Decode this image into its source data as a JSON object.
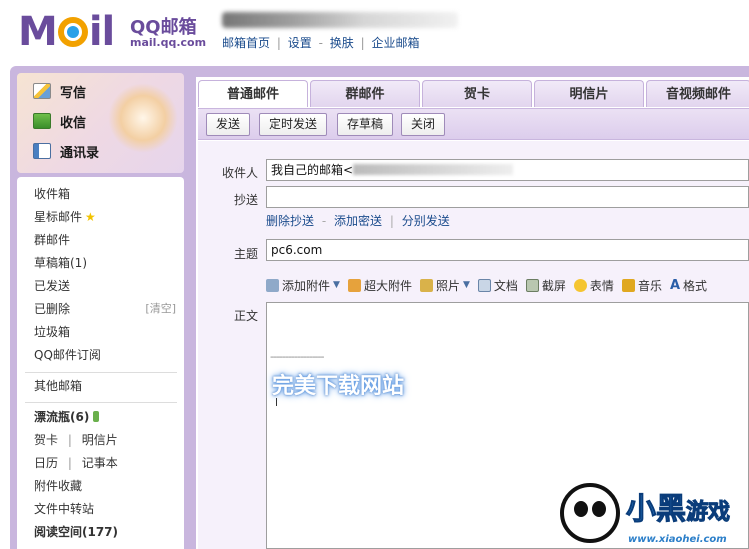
{
  "header": {
    "brand_title": "QQ邮箱",
    "brand_sub": "mail.qq.com",
    "links": [
      "邮箱首页",
      "设置",
      "换肤",
      "企业邮箱"
    ],
    "link_sep_1": "|",
    "link_sep_2": "-",
    "link_sep_3": "|"
  },
  "sidebar": {
    "actions": [
      {
        "label": "写信",
        "icon": "pencil-paper-icon"
      },
      {
        "label": "收信",
        "icon": "inbox-download-icon"
      },
      {
        "label": "通讯录",
        "icon": "address-book-icon"
      }
    ],
    "folders": [
      "收件箱",
      "星标邮件",
      "群邮件",
      "草稿箱(1)",
      "已发送",
      "已删除",
      "垃圾箱",
      "QQ邮件订阅"
    ],
    "clear_label": "[清空]",
    "other_mailbox": "其他邮箱",
    "drift_bottle": "漂流瓶(6)",
    "card": "贺卡",
    "postcard": "明信片",
    "calendar": "日历",
    "notes": "记事本",
    "attachments": "附件收藏",
    "file_transfer": "文件中转站",
    "reading": "阅读空间(177)",
    "pipe": "|"
  },
  "compose": {
    "tabs": [
      "普通邮件",
      "群邮件",
      "贺卡",
      "明信片",
      "音视频邮件"
    ],
    "toolbar": [
      "发送",
      "定时发送",
      "存草稿",
      "关闭"
    ],
    "to_label": "收件人",
    "to_value": "我自己的邮箱<",
    "cc_label": "抄送",
    "cc_value": "",
    "cc_links": [
      "删除抄送",
      "添加密送",
      "分别发送"
    ],
    "cc_sep_1": "-",
    "cc_sep_2": "|",
    "subject_label": "主题",
    "subject_value": "pc6.com",
    "edit_tools": [
      {
        "label": "添加附件",
        "icon": "paperclip-icon",
        "dropdown": true
      },
      {
        "label": "超大附件",
        "icon": "big-attachment-icon",
        "dropdown": false
      },
      {
        "label": "照片",
        "icon": "photo-icon",
        "dropdown": true
      },
      {
        "label": "文档",
        "icon": "document-icon",
        "dropdown": false
      },
      {
        "label": "截屏",
        "icon": "screenshot-icon",
        "dropdown": false
      },
      {
        "label": "表情",
        "icon": "smiley-icon",
        "dropdown": false
      },
      {
        "label": "音乐",
        "icon": "music-note-icon",
        "dropdown": false
      },
      {
        "label": "格式",
        "icon": "text-format-icon",
        "dropdown": false
      }
    ],
    "body_label": "正文",
    "signature_line": "------------------",
    "watermark": "完美下载网站"
  },
  "site_logo": {
    "title_a": "小黑",
    "title_b": "游戏",
    "url": "www.xiaohei.com"
  },
  "colors": {
    "brand": "#6a4c9c",
    "frame": "#c9b6de",
    "link": "#1a4b8c"
  }
}
